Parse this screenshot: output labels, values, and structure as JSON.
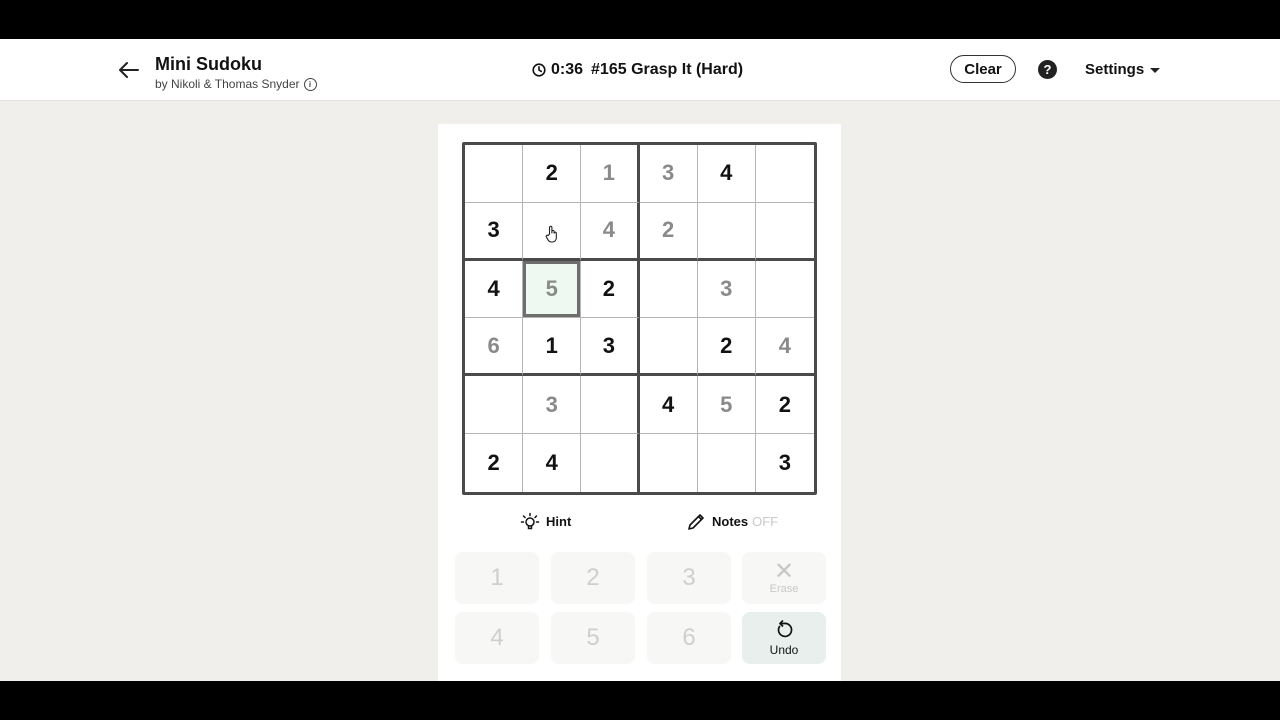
{
  "header": {
    "title": "Mini Sudoku",
    "byline": "by Nikoli & Thomas Snyder",
    "timer": "0:36",
    "puzzle": "#165 Grasp It (Hard)",
    "clear_label": "Clear",
    "help_label": "?",
    "settings_label": "Settings"
  },
  "board": {
    "rows": [
      [
        {
          "v": "",
          "t": "empty"
        },
        {
          "v": "2",
          "t": "given"
        },
        {
          "v": "1",
          "t": "user"
        },
        {
          "v": "3",
          "t": "user"
        },
        {
          "v": "4",
          "t": "given"
        },
        {
          "v": "",
          "t": "empty"
        }
      ],
      [
        {
          "v": "3",
          "t": "given"
        },
        {
          "v": "",
          "t": "empty"
        },
        {
          "v": "4",
          "t": "user"
        },
        {
          "v": "2",
          "t": "user"
        },
        {
          "v": "",
          "t": "empty"
        },
        {
          "v": "",
          "t": "empty"
        }
      ],
      [
        {
          "v": "4",
          "t": "given"
        },
        {
          "v": "5",
          "t": "user",
          "selected": true
        },
        {
          "v": "2",
          "t": "given"
        },
        {
          "v": "",
          "t": "empty"
        },
        {
          "v": "3",
          "t": "user"
        },
        {
          "v": "",
          "t": "empty"
        }
      ],
      [
        {
          "v": "6",
          "t": "user"
        },
        {
          "v": "1",
          "t": "given"
        },
        {
          "v": "3",
          "t": "given"
        },
        {
          "v": "",
          "t": "empty"
        },
        {
          "v": "2",
          "t": "given"
        },
        {
          "v": "4",
          "t": "user"
        }
      ],
      [
        {
          "v": "",
          "t": "empty"
        },
        {
          "v": "3",
          "t": "user"
        },
        {
          "v": "",
          "t": "empty"
        },
        {
          "v": "4",
          "t": "given"
        },
        {
          "v": "5",
          "t": "user"
        },
        {
          "v": "2",
          "t": "given"
        }
      ],
      [
        {
          "v": "2",
          "t": "given"
        },
        {
          "v": "4",
          "t": "given"
        },
        {
          "v": "",
          "t": "empty"
        },
        {
          "v": "",
          "t": "empty"
        },
        {
          "v": "",
          "t": "empty"
        },
        {
          "v": "3",
          "t": "given"
        }
      ]
    ]
  },
  "tools": {
    "hint_label": "Hint",
    "notes_label": "Notes",
    "notes_state": "OFF"
  },
  "keypad": {
    "keys": [
      "1",
      "2",
      "3",
      "4",
      "5",
      "6"
    ],
    "erase_label": "Erase",
    "erase_symbol": "✕",
    "undo_label": "Undo"
  }
}
